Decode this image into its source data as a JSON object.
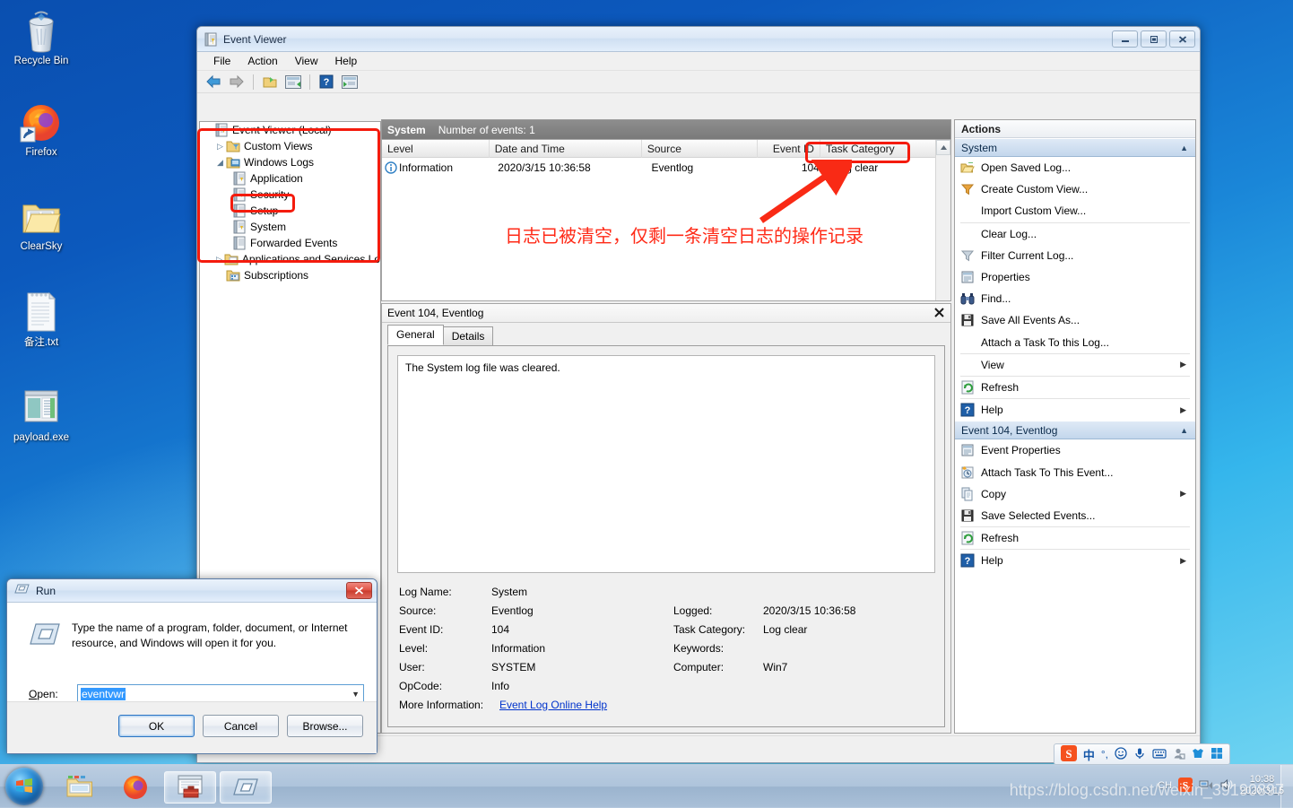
{
  "desktop": {
    "icons": [
      {
        "name": "recycle-bin",
        "label": "Recycle Bin"
      },
      {
        "name": "firefox",
        "label": "Firefox"
      },
      {
        "name": "clearsky-folder",
        "label": "ClearSky"
      },
      {
        "name": "notes-txt",
        "label": "备注.txt"
      },
      {
        "name": "payload-exe",
        "label": "payload.exe"
      }
    ]
  },
  "event_viewer": {
    "title": "Event Viewer",
    "window_buttons": {
      "minimize": "minimize",
      "maximize": "maximize",
      "close": "close"
    },
    "menu": [
      "File",
      "Action",
      "View",
      "Help"
    ],
    "toolbar_icons": [
      "back-arrow-icon",
      "forward-arrow-icon",
      "show-hide-console-tree-icon",
      "properties-icon",
      "help-icon",
      "show-hide-action-pane-icon"
    ],
    "tree": [
      {
        "label": "Event Viewer (Local)",
        "indent": 0,
        "twisty": "",
        "icon": "event-viewer-icon"
      },
      {
        "label": "Custom Views",
        "indent": 1,
        "twisty": "collapsed",
        "icon": "custom-views-folder-icon"
      },
      {
        "label": "Windows Logs",
        "indent": 1,
        "twisty": "expanded",
        "icon": "windows-logs-icon"
      },
      {
        "label": "Application",
        "indent": 2,
        "twisty": "",
        "icon": "log-icon"
      },
      {
        "label": "Security",
        "indent": 2,
        "twisty": "",
        "icon": "log-icon"
      },
      {
        "label": "Setup",
        "indent": 2,
        "twisty": "",
        "icon": "log-plain-icon"
      },
      {
        "label": "System",
        "indent": 2,
        "twisty": "",
        "icon": "log-icon",
        "selected": true
      },
      {
        "label": "Forwarded Events",
        "indent": 2,
        "twisty": "",
        "icon": "log-plain-icon"
      },
      {
        "label": "Applications and Services Lo",
        "indent": 1,
        "twisty": "collapsed",
        "icon": "app-services-folder-icon"
      },
      {
        "label": "Subscriptions",
        "indent": 1,
        "twisty": "",
        "icon": "subscriptions-icon"
      }
    ],
    "list_header": {
      "log_name": "System",
      "count_label": "Number of events: 1"
    },
    "columns": [
      "Level",
      "Date and Time",
      "Source",
      "Event ID",
      "Task Category"
    ],
    "rows": [
      {
        "level": "Information",
        "datetime": "2020/3/15 10:36:58",
        "source": "Eventlog",
        "event_id": "104",
        "task_category": "Log clear"
      }
    ],
    "details": {
      "header": "Event 104, Eventlog",
      "close": "×",
      "tabs": [
        {
          "label": "General",
          "active": true
        },
        {
          "label": "Details",
          "active": false
        }
      ],
      "message": "The System log file was cleared.",
      "fields": [
        {
          "label1": "Log Name:",
          "value1": "System",
          "label2": "",
          "value2": ""
        },
        {
          "label1": "Source:",
          "value1": "Eventlog",
          "label2": "Logged:",
          "value2": "2020/3/15 10:36:58"
        },
        {
          "label1": "Event ID:",
          "value1": "104",
          "label2": "Task Category:",
          "value2": "Log clear"
        },
        {
          "label1": "Level:",
          "value1": "Information",
          "label2": "Keywords:",
          "value2": ""
        },
        {
          "label1": "User:",
          "value1": "SYSTEM",
          "label2": "Computer:",
          "value2": "Win7"
        },
        {
          "label1": "OpCode:",
          "value1": "Info",
          "label2": "",
          "value2": ""
        }
      ],
      "more_info_label": "More Information:",
      "more_info_link": "Event Log Online Help"
    },
    "actions": {
      "title": "Actions",
      "groups": [
        {
          "header": "System",
          "collapse": "▲",
          "items": [
            {
              "label": "Open Saved Log...",
              "icon": "open-folder-icon",
              "submenu": false
            },
            {
              "label": "Create Custom View...",
              "icon": "filter-icon",
              "submenu": false
            },
            {
              "label": "Import Custom View...",
              "icon": "",
              "submenu": false
            },
            {
              "label": "Clear Log...",
              "icon": "",
              "submenu": false,
              "separator_before": true
            },
            {
              "label": "Filter Current Log...",
              "icon": "filter-icon",
              "submenu": false
            },
            {
              "label": "Properties",
              "icon": "properties-icon",
              "submenu": false
            },
            {
              "label": "Find...",
              "icon": "binoculars-icon",
              "submenu": false
            },
            {
              "label": "Save All Events As...",
              "icon": "save-icon",
              "submenu": false
            },
            {
              "label": "Attach a Task To this Log...",
              "icon": "",
              "submenu": false
            },
            {
              "label": "View",
              "icon": "",
              "submenu": true,
              "separator_before": true
            },
            {
              "label": "Refresh",
              "icon": "refresh-icon",
              "submenu": false
            },
            {
              "label": "Help",
              "icon": "help-icon",
              "submenu": true
            }
          ]
        },
        {
          "header": "Event 104, Eventlog",
          "collapse": "▲",
          "items": [
            {
              "label": "Event Properties",
              "icon": "properties-icon",
              "submenu": false
            },
            {
              "label": "Attach Task To This Event...",
              "icon": "attach-task-icon",
              "submenu": false
            },
            {
              "label": "Copy",
              "icon": "copy-icon",
              "submenu": true
            },
            {
              "label": "Save Selected Events...",
              "icon": "save-icon",
              "submenu": false
            },
            {
              "label": "Refresh",
              "icon": "refresh-icon",
              "submenu": false
            },
            {
              "label": "Help",
              "icon": "help-icon",
              "submenu": true
            }
          ]
        }
      ]
    }
  },
  "annotations": {
    "note_text": "日志已被清空，仅剩一条清空日志的操作记录",
    "color": "#ff2a17",
    "boxes": [
      "windows-logs-tree",
      "system-node",
      "event-id-cell"
    ],
    "arrow": "red-arrow-pointing-to-event-id"
  },
  "run_dialog": {
    "title": "Run",
    "description": "Type the name of a program, folder, document, or Internet resource, and Windows will open it for you.",
    "open_label": "Open:",
    "open_value": "eventvwr",
    "buttons": {
      "ok": "OK",
      "cancel": "Cancel",
      "browse": "Browse..."
    }
  },
  "taskbar": {
    "start": "start-orb",
    "pinned": [
      "explorer-icon",
      "firefox-icon",
      "toolbox-icon",
      "run-window-icon"
    ],
    "tray_ime": [
      "sogou-logo-icon",
      "中",
      "°,",
      "smiley-icon",
      "microphone-icon",
      "keyboard-icon",
      "user-icon",
      "skin-icon",
      "menu-icon"
    ],
    "tray": [
      "CH",
      "sogou-icon",
      "network-icon",
      "volume-icon"
    ],
    "clock_time": "10:38",
    "clock_date": "2020/3/15"
  },
  "watermark": "https://blog.csdn.net/weixin_39190897"
}
